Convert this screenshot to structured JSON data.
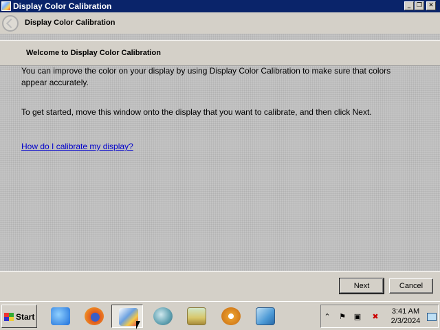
{
  "window": {
    "title": "Display Color Calibration",
    "controls": {
      "minimize": "_",
      "restore": "❐",
      "close": "✕"
    }
  },
  "nav": {
    "title": "Display Color Calibration"
  },
  "content": {
    "heading": "Welcome to Display Color Calibration",
    "paragraph1": "You can improve the color on your display by using Display Color Calibration to make sure that colors appear accurately.",
    "paragraph2": "To get started, move this window onto the display that you want to calibrate, and then click Next.",
    "help_link": "How do I calibrate my display?"
  },
  "buttons": {
    "next": "Next",
    "cancel": "Cancel"
  },
  "taskbar": {
    "start_label": "Start",
    "apps": [
      {
        "name": "internet-explorer-icon",
        "color": "#1e6fd9"
      },
      {
        "name": "firefox-icon",
        "color": "#e0591e"
      },
      {
        "name": "color-calibration-icon",
        "color": "#6aa0e0",
        "active": true
      },
      {
        "name": "globe-icon",
        "color": "#5fa0b0"
      },
      {
        "name": "photo-viewer-icon",
        "color": "#d8c76a"
      },
      {
        "name": "media-player-icon",
        "color": "#e89b2b"
      },
      {
        "name": "network-icon",
        "color": "#4d9ad6"
      }
    ],
    "clock": {
      "time": "3:41 AM",
      "date": "2/3/2024"
    }
  }
}
